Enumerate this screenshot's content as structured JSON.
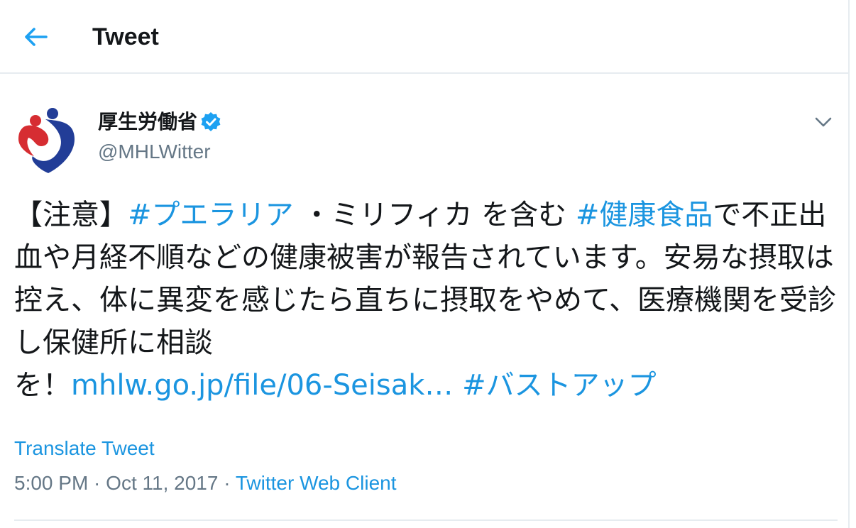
{
  "header": {
    "title": "Tweet",
    "back_icon": "arrow-left-icon"
  },
  "author": {
    "display_name": "厚生労働省",
    "handle": "@MHLWitter",
    "verified": true,
    "avatar_icon": "mhlw-logo"
  },
  "tweet": {
    "segments": [
      {
        "text": "【注意】",
        "link": false
      },
      {
        "text": "#プエラリア",
        "link": true
      },
      {
        "text": " ・ミリフィカ を含む ",
        "link": false
      },
      {
        "text": "#健康食品",
        "link": true
      },
      {
        "text": "で不正出血や月経不順などの健康被害が報告されています。安易な摂取は控え、体に異変を感じたら直ちに摂取をやめて、医療機関を受診し保健所に相談",
        "link": false
      },
      {
        "text": "を！",
        "link": false
      },
      {
        "text": "mhlw.go.jp/file/06-Seisak…",
        "link": true
      },
      {
        "text": " ",
        "link": false
      },
      {
        "text": "#バストアップ",
        "link": true
      }
    ]
  },
  "translate_label": "Translate Tweet",
  "meta": {
    "time": "5:00 PM",
    "separator": " · ",
    "date": "Oct 11, 2017",
    "source": "Twitter Web Client"
  },
  "colors": {
    "accent": "#1b95e0",
    "text": "#14171a",
    "secondary": "#657786",
    "border": "#e6ecf0"
  }
}
